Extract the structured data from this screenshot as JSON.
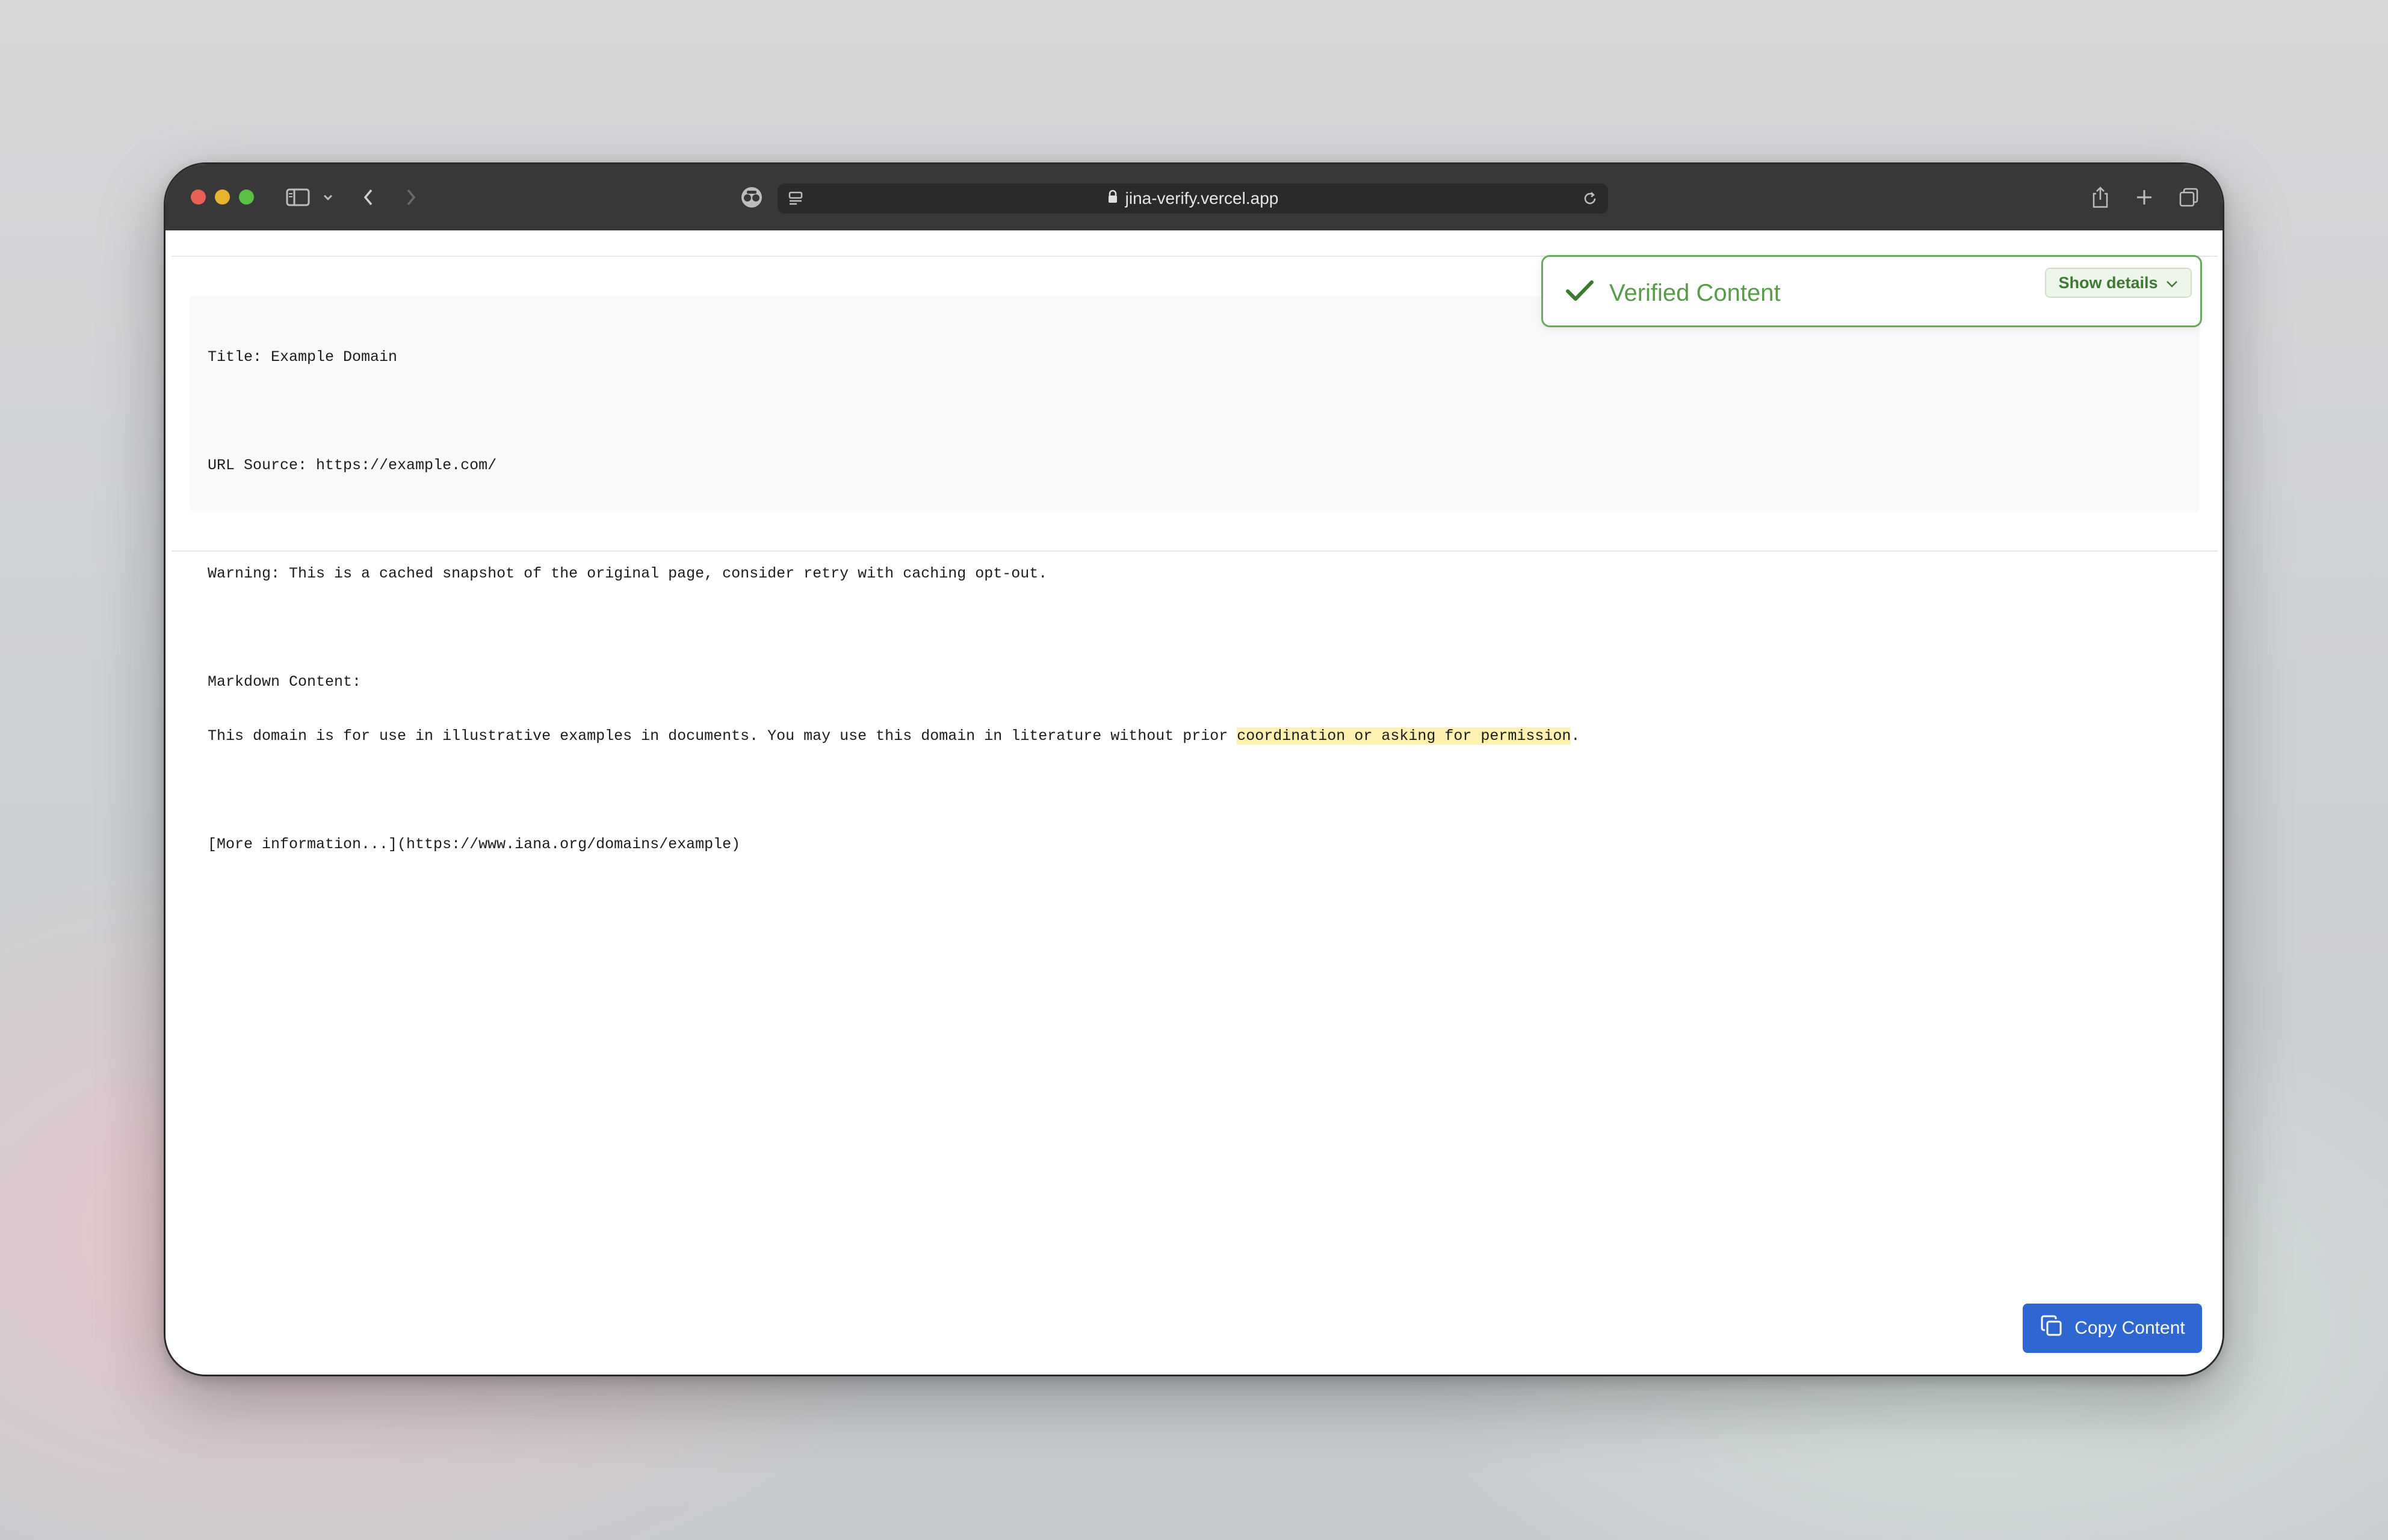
{
  "browser": {
    "url": "jina-verify.vercel.app"
  },
  "verification": {
    "status_label": "Verified Content",
    "details_label": "Show details",
    "status_color": "#5a9a4c"
  },
  "document": {
    "lines": [
      "Title: Example Domain",
      "URL Source: https://example.com/",
      "Warning: This is a cached snapshot of the original page, consider retry with caching opt-out.",
      "Markdown Content:",
      "This domain is for use in illustrative examples in documents. You may use this domain in literature without prior ",
      "coordination or asking for permission",
      ".",
      "[More information...](https://www.iana.org/domains/example)"
    ]
  },
  "actions": {
    "copy_label": "Copy Content",
    "accent_color": "#2f67d2"
  },
  "icons": {
    "sidebar": "sidebar-icon",
    "back": "chevron-left-icon",
    "forward": "chevron-right-icon",
    "privacy": "privacy-report-icon",
    "reader": "page-menu-icon",
    "lock": "lock-icon",
    "reload": "reload-icon",
    "share": "share-icon",
    "new_tab": "plus-icon",
    "tabs": "tab-overview-icon",
    "check": "check-icon",
    "copy": "copy-icon"
  }
}
